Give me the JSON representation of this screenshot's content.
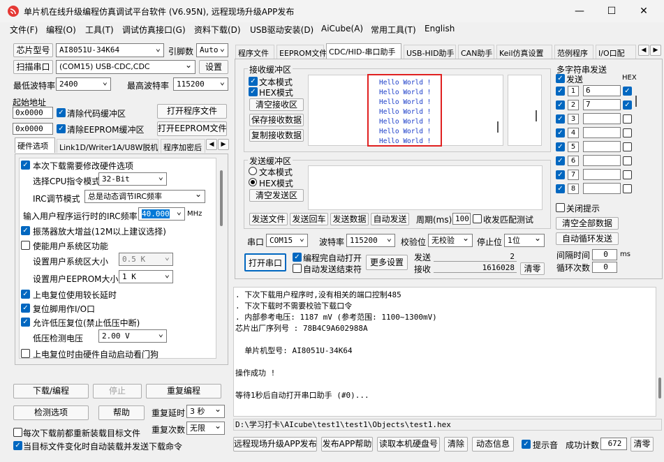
{
  "window": {
    "title": "单片机在线升级编程仿真调试平台软件 (V6.95N), 远程现场升级APP发布",
    "minimize": "—",
    "maximize": "☐",
    "close": "✕"
  },
  "menu": [
    "文件(F)",
    "编程(O)",
    "工具(T)",
    "调试仿真接口(G)",
    "资料下载(D)",
    "USB驱动安装(D)",
    "AiCube(A)",
    "常用工具(T)",
    "English"
  ],
  "left": {
    "chip_btn": "芯片型号",
    "chip_value": "AI8051U-34K64",
    "pins_label": "引脚数",
    "pins_value": "Auto",
    "scan_btn": "扫描串口",
    "port_value": "(COM15) USB-CDC,CDC",
    "settings_btn": "设置",
    "min_baud_label": "最低波特率",
    "min_baud": "2400",
    "max_baud_label": "最高波特率",
    "max_baud": "115200",
    "start_addr_label": "起始地址",
    "addr1": "0x0000",
    "clear_code": "清除代码缓冲区",
    "open_prog": "打开程序文件",
    "addr2": "0x0000",
    "clear_eeprom": "清除EEPROM缓冲区",
    "open_eeprom": "打开EEPROM文件",
    "tabs": [
      "硬件选项",
      "Link1D/Writer1A/U8W脱机",
      "程序加密后"
    ],
    "hw": {
      "reset_opt": "本次下载需要修改硬件选项",
      "cpu_mode_label": "选择CPU指令模式",
      "cpu_mode": "32-Bit",
      "irc_label": "IRC调节模式",
      "irc_mode": "总是动态调节IRC频率",
      "freq_label": "输入用户程序运行时的IRC频率",
      "freq_value": "40.000",
      "freq_unit": "MHz",
      "osc_gain": "振荡器放大增益(12M以上建议选择)",
      "enable_sys": "使能用户系统区功能",
      "sys_size_label": "设置用户系统区大小",
      "sys_size": "0.5 K",
      "eeprom_size_label": "设置用户EEPROM大小",
      "eeprom_size": "1   K",
      "por_delay": "上电复位使用较长延时",
      "reset_pin": "复位脚用作I/O口",
      "lvr": "允许低压复位(禁止低压中断)",
      "lvd_label": "低压检测电压",
      "lvd": "2.00 V",
      "wdt": "上电复位时由硬件自动启动看门狗"
    },
    "download_btn": "下载/编程",
    "stop_btn": "停止",
    "reprog_btn": "重复编程",
    "detect_btn": "检测选项",
    "help_btn": "帮助",
    "delay_label": "重复延时",
    "delay": "3 秒",
    "reload_label": "每次下载前都重新装载目标文件",
    "repeat_label": "重复次数",
    "repeat": "无限",
    "autoload_label": "当目标文件变化时自动装载并发送下载命令"
  },
  "right": {
    "tabs": [
      "程序文件",
      "EEPROM文件",
      "CDC/HID-串口助手",
      "USB-HID助手",
      "CAN助手",
      "Keil仿真设置",
      "范例程序",
      "I/O口配"
    ],
    "rx_label": "接收缓冲区",
    "text_mode": "文本模式",
    "hex_mode": "HEX模式",
    "clear_rx": "清空接收区",
    "save_rx": "保存接收数据",
    "copy_rx": "复制接收数据",
    "rx_lines": [
      "Hello World !",
      "Hello World !",
      "Hello World !",
      "Hello World !",
      "Hello World !",
      "Hello World !",
      "Hello World !"
    ],
    "tx_label": "发送缓冲区",
    "tx_text_mode": "文本模式",
    "tx_hex_mode": "HEX模式",
    "clear_tx": "清空发送区",
    "send_file": "发送文件",
    "send_return": "发送回车",
    "send_data": "发送数据",
    "auto_send": "自动发送",
    "period_label": "周期(ms)",
    "period": "100",
    "match_test": "收发匹配测试",
    "port_label": "串口",
    "port": "COM15",
    "baud_label": "波特率",
    "baud": "115200",
    "parity_label": "校验位",
    "parity": "无校验",
    "stop_label": "停止位",
    "stop": "1位",
    "open_port": "打开串口",
    "auto_open": "编程完自动打开",
    "auto_end": "自动发送结束符",
    "more": "更多设置",
    "send_label": "发送",
    "send_count": "2",
    "recv_label": "接收",
    "recv_count": "1616028",
    "clear_count": "清零",
    "multi_label": "多字符串发送",
    "send_col": "发送",
    "hex_col": "HEX",
    "multi_rows": [
      {
        "n": "1",
        "v": "6"
      },
      {
        "n": "2",
        "v": "7"
      },
      {
        "n": "3",
        "v": ""
      },
      {
        "n": "4",
        "v": ""
      },
      {
        "n": "5",
        "v": ""
      },
      {
        "n": "6",
        "v": ""
      },
      {
        "n": "7",
        "v": ""
      },
      {
        "n": "8",
        "v": ""
      }
    ],
    "close_tip": "关闭提示",
    "clear_all": "清空全部数据",
    "auto_loop": "自动循环发送",
    "interval_label": "间隔时间",
    "interval": "0",
    "interval_unit": "ms",
    "loop_label": "循环次数",
    "loop": "0"
  },
  "log": {
    "lines": [
      ". 下次下载用户程序时,没有相关的端口控制485",
      ". 下次下载时不需要校验下载口令",
      ". 内部参考电压: 1187 mV (参考范围: 1100~1300mV)",
      "芯片出厂序列号 : 78B4C9A602988A",
      "",
      "  单片机型号: AI8051U-34K64",
      "",
      "操作成功 !",
      "",
      "等待1秒后自动打开串口助手 (#0)..."
    ],
    "path": "D:\\学习打卡\\AIcube\\test1\\test1\\Objects\\test1.hex"
  },
  "bottom": {
    "publish": "远程现场升级APP发布",
    "publish_help": "发布APP帮助",
    "read_disk": "读取本机硬盘号",
    "clear": "清除",
    "animation": "动态信息",
    "beep": "提示音",
    "success_label": "成功计数",
    "success": "672",
    "clear2": "清零"
  },
  "colors": {
    "accent": "#0067c0",
    "highlight": "#e02020",
    "hello": "#1a3cc8"
  }
}
